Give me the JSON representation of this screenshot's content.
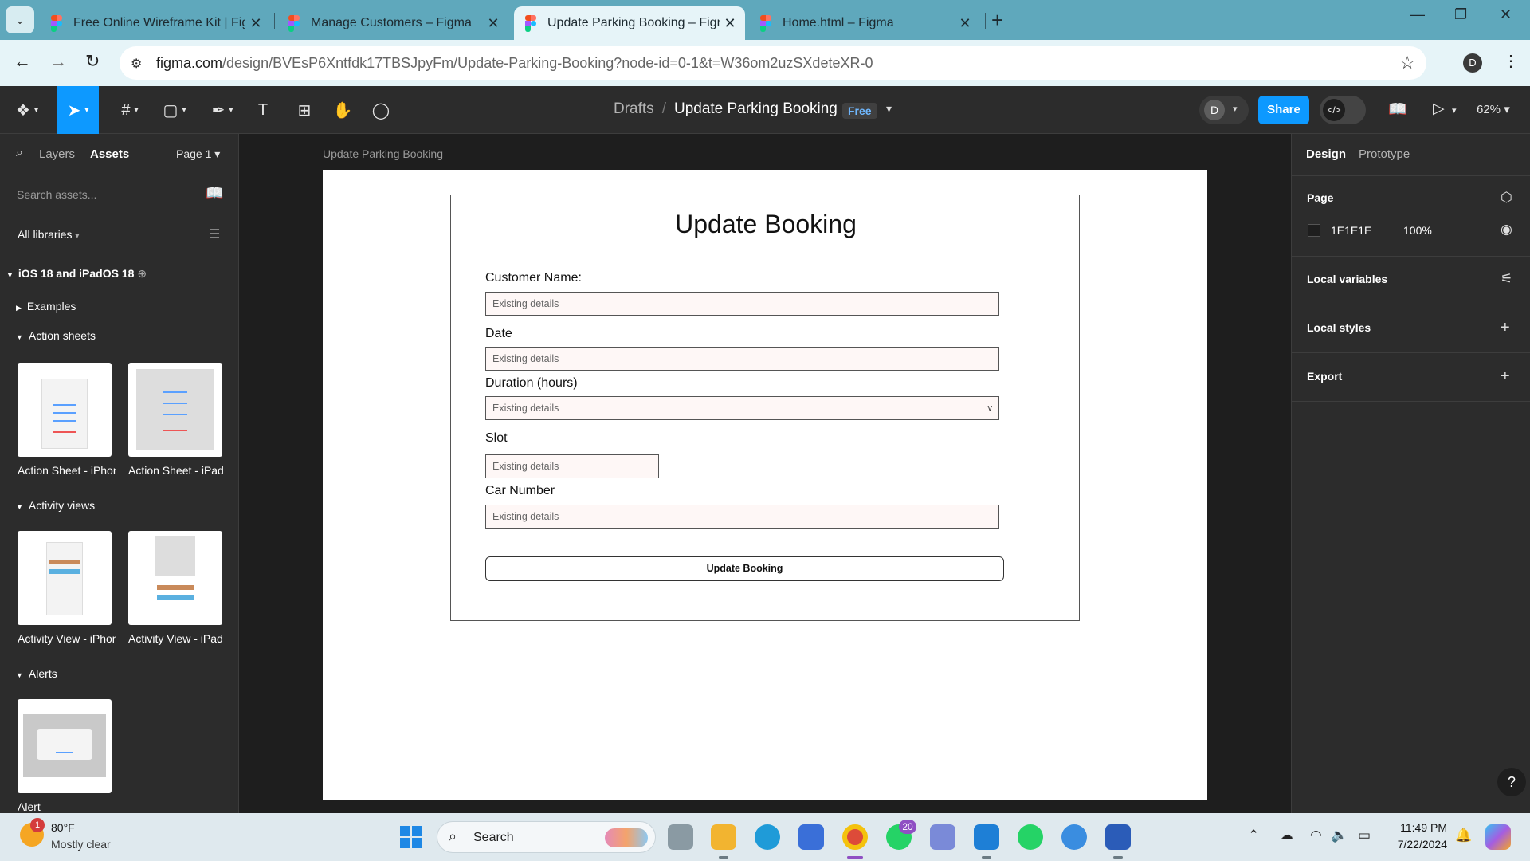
{
  "browser": {
    "tabs": [
      {
        "label": "Free Online Wireframe Kit | Figma",
        "active": false
      },
      {
        "label": "Manage Customers – Figma",
        "active": false
      },
      {
        "label": "Update Parking Booking – Figma",
        "active": true
      },
      {
        "label": "Home.html – Figma",
        "active": false
      }
    ],
    "url_host": "figma.com",
    "url_path": "/design/BVEsP6Xntfdk17TBSJpyFm/Update-Parking-Booking?node-id=0-1&t=W36om2uzSXdeteXR-0",
    "profile_initial": "D"
  },
  "toolbar": {
    "breadcrumb_folder": "Drafts",
    "file_name": "Update Parking Booking",
    "plan_badge": "Free",
    "user_initial": "D",
    "share_label": "Share",
    "zoom": "62%"
  },
  "left_panel": {
    "tabs": [
      "Layers",
      "Assets"
    ],
    "page_selector": "Page 1",
    "search_placeholder": "Search assets...",
    "libraries_filter": "All libraries",
    "library_name": "iOS 18 and iPadOS 18",
    "sections": [
      {
        "title": "Examples",
        "expanded": false
      },
      {
        "title": "Action sheets",
        "expanded": true
      },
      {
        "title": "Activity views",
        "expanded": true
      },
      {
        "title": "Alerts",
        "expanded": true
      }
    ],
    "assets": {
      "action_sheets": [
        "Action Sheet - iPhone",
        "Action Sheet - iPad"
      ],
      "activity_views": [
        "Activity View - iPhone",
        "Activity View - iPad"
      ],
      "alerts": [
        "Alert"
      ]
    }
  },
  "canvas": {
    "frame_name": "Update Parking Booking",
    "form": {
      "title": "Update Booking",
      "fields": [
        {
          "label": "Customer Name:",
          "placeholder": "Existing details",
          "type": "text"
        },
        {
          "label": "Date",
          "placeholder": "Existing details",
          "type": "text"
        },
        {
          "label": "Duration (hours)",
          "placeholder": "Existing details",
          "type": "select",
          "dropdown_glyph": "v"
        },
        {
          "label": "Slot",
          "placeholder": "Existing details",
          "type": "text"
        },
        {
          "label": "Car Number",
          "placeholder": "Existing details",
          "type": "text"
        }
      ],
      "submit_label": "Update Booking"
    }
  },
  "right_panel": {
    "tabs": [
      "Design",
      "Prototype"
    ],
    "page_heading": "Page",
    "page_color": "1E1E1E",
    "page_opacity": "100%",
    "sections": [
      "Local variables",
      "Local styles",
      "Export"
    ]
  },
  "taskbar": {
    "temperature": "80°F",
    "condition": "Mostly clear",
    "weather_badge": "1",
    "search_label": "Search",
    "whatsapp_badge": "20",
    "time": "11:49 PM",
    "date": "7/22/2024"
  },
  "colors": {
    "accent": "#0d99ff",
    "tab_bar": "#5fa8bc",
    "canvas_bg": "#1e1e1e",
    "panel_bg": "#2c2c2c",
    "input_bg": "#fef7f6"
  }
}
